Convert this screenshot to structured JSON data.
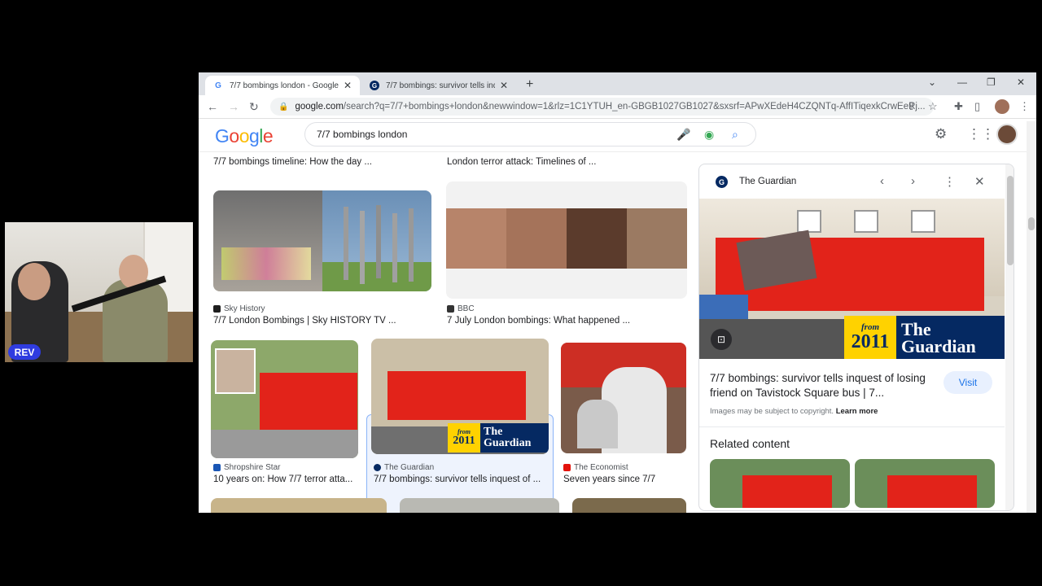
{
  "overlay": {
    "badge_label": "REV"
  },
  "browser": {
    "tabs": [
      {
        "title": "7/7 bombings london - Google S",
        "favicon": "google-icon",
        "active": true
      },
      {
        "title": "7/7 bombings: survivor tells inq",
        "favicon": "guardian-icon",
        "active": false
      }
    ],
    "address": {
      "host": "google.com",
      "path": "/search?q=7/7+bombings+london&newwindow=1&rlz=1C1YTUH_en-GBGB1027GB1027&sxsrf=APwXEdeH4CZQNTq-AffITiqexkCrwEeRj..."
    }
  },
  "google": {
    "logo": "Google",
    "query": "7/7 bombings london",
    "colors": {
      "blue": "#4285f4",
      "red": "#ea4335",
      "yellow": "#fbbc05",
      "green": "#34a853"
    }
  },
  "results": {
    "top_captions": [
      "7/7 bombings timeline: How the day ...",
      "London terror attack: Timelines of ..."
    ],
    "row1": [
      {
        "source": "Sky History",
        "caption": "7/7 London Bombings | Sky HISTORY TV ..."
      },
      {
        "source": "BBC",
        "caption": "7 July London bombings: What happened ..."
      }
    ],
    "row2": [
      {
        "source": "Shropshire Star",
        "caption": "10 years on: How 7/7 terror atta..."
      },
      {
        "source": "The Guardian",
        "caption": "7/7 bombings: survivor tells inquest of ..."
      },
      {
        "source": "The Economist",
        "caption": "Seven years since 7/7"
      }
    ],
    "guardian_badge": {
      "from": "from",
      "year": "2011",
      "word1": "The",
      "word2": "Guardian"
    }
  },
  "panel": {
    "site": "The Guardian",
    "title": "7/7 bombings: survivor tells inquest of losing friend on Tavistock Square bus | 7...",
    "visit_label": "Visit",
    "copyright_text": "Images may be subject to copyright.",
    "learn_more": "Learn more",
    "related_heading": "Related content"
  }
}
